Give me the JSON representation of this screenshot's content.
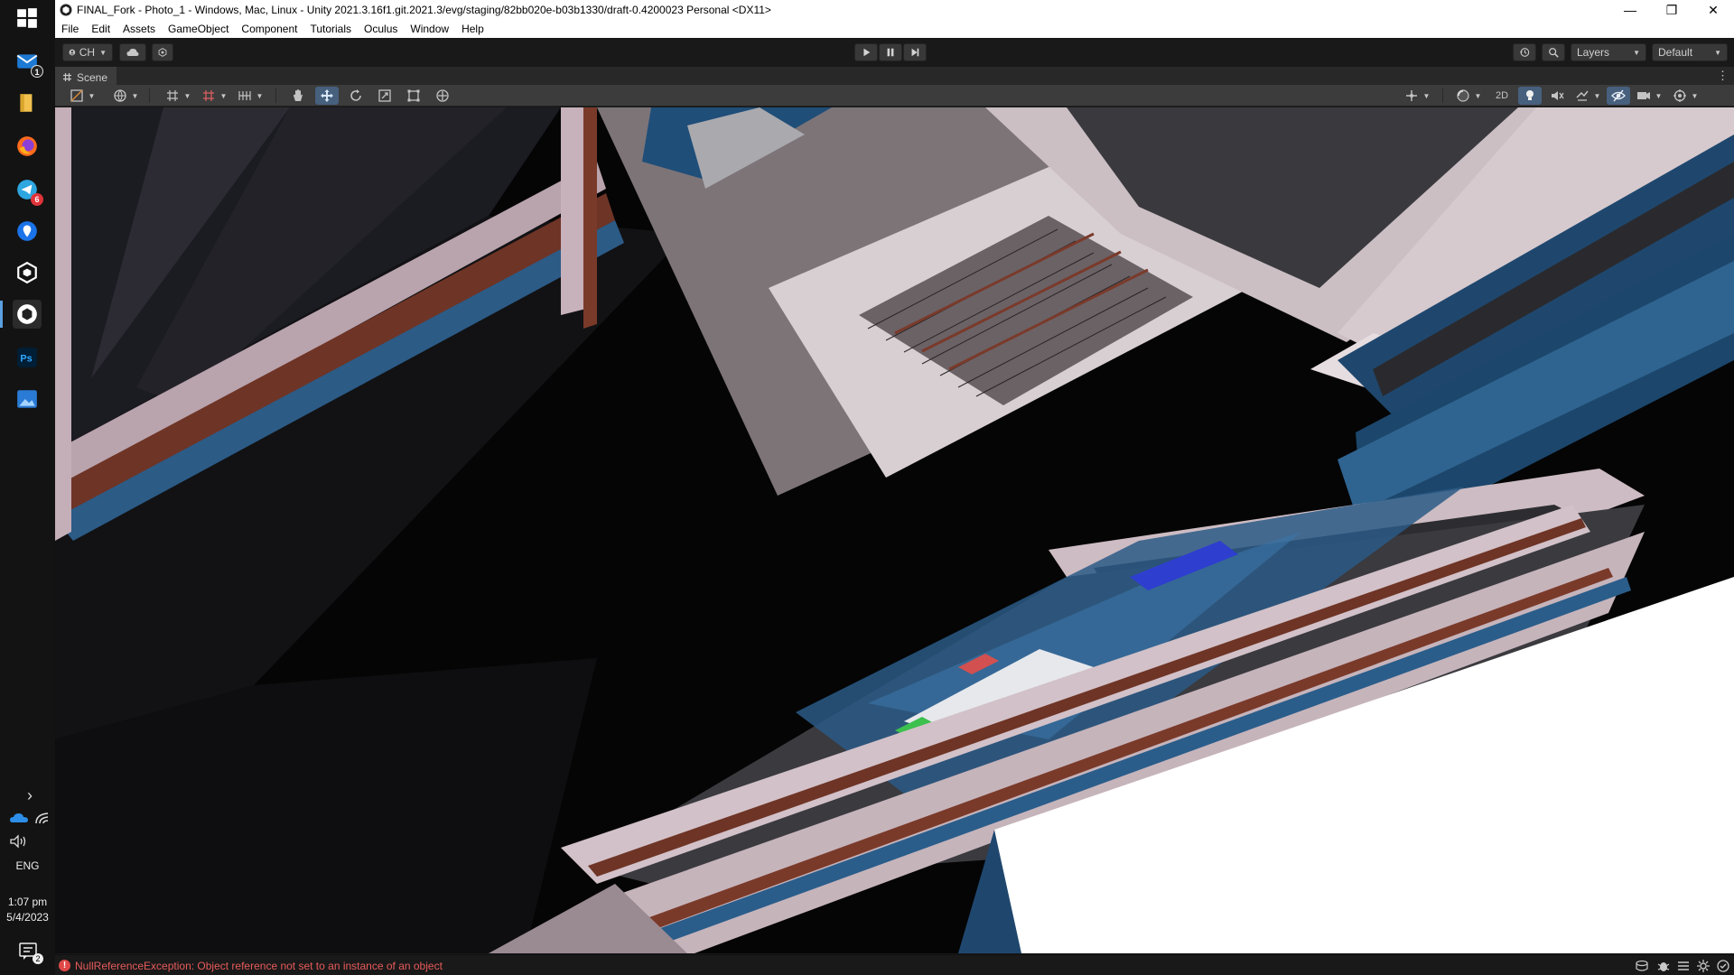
{
  "window": {
    "title": "FINAL_Fork - Photo_1 - Windows, Mac, Linux - Unity 2021.3.16f1.git.2021.3/evg/staging/82bb020e-b03b1330/draft-0.4200023 Personal <DX11>",
    "minimize_glyph": "—",
    "maximize_glyph": "❐",
    "close_glyph": "✕"
  },
  "menu": {
    "items": [
      "File",
      "Edit",
      "Assets",
      "GameObject",
      "Component",
      "Tutorials",
      "Oculus",
      "Window",
      "Help"
    ]
  },
  "toolbar": {
    "account_label": "CH",
    "layers_label": "Layers",
    "layout_label": "Default"
  },
  "scene": {
    "tab_label": "Scene",
    "menu_glyph": "⋮",
    "mode_2d_label": "2D"
  },
  "taskbar": {
    "mail_badge": "1",
    "telegram_badge": "6",
    "tray_chevron": "›",
    "language": "ENG",
    "time": "1:07 pm",
    "date": "5/4/2023",
    "notification_count": "2",
    "icons": [
      "windows-start-icon",
      "mail-icon",
      "file-explorer-icon",
      "firefox-icon",
      "telegram-icon",
      "maps-icon",
      "unity-hub-icon",
      "unity-editor-icon",
      "photoshop-icon",
      "photos-icon"
    ]
  },
  "status": {
    "error_glyph": "!",
    "message": "NullReferenceException: Object reference not set to an instance of an object"
  },
  "colors": {
    "accent_active": "#46607e",
    "error_text": "#e85a5a",
    "editor_bg": "#191919"
  }
}
